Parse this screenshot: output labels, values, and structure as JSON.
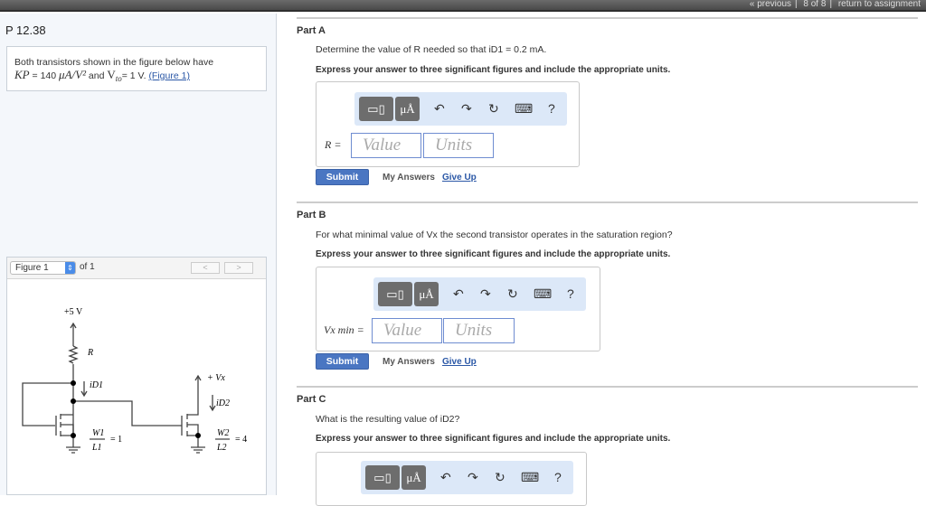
{
  "topbar": {
    "previous": "« previous",
    "position": "8 of 8",
    "return": "return to assignment"
  },
  "problem": {
    "title": "P 12.38",
    "text1": "Both transistors shown in the figure below have",
    "kp": "KP",
    "kp_val": "= 140",
    "kp_units": "μA/V²",
    "and": "and",
    "vto": "V",
    "vto_sub": "to",
    "vto_val": "= 1 V.",
    "figure_link": "(Figure 1)"
  },
  "figure": {
    "select": "Figure 1",
    "of": "of 1",
    "prev": "<",
    "next": ">",
    "labels": {
      "supply": "+5 V",
      "r": "R",
      "id1": "iD1",
      "vx": "+ Vx",
      "id2": "iD2",
      "w1": "W1",
      "l1": "L1",
      "ratio1": "= 1",
      "w2": "W2",
      "l2": "L2",
      "ratio2": "= 4"
    }
  },
  "toolbar": {
    "template": "▭",
    "units": "μÅ",
    "undo": "↶",
    "redo": "↷",
    "reset": "↻",
    "keyboard": "⌨",
    "help": "?"
  },
  "common": {
    "express": "Express your answer to three significant figures and include the appropriate units.",
    "value_ph": "Value",
    "units_ph": "Units",
    "submit": "Submit",
    "my_answers": "My Answers",
    "give_up": "Give Up"
  },
  "partA": {
    "title": "Part A",
    "question": "Determine the value of R needed so that iD1 = 0.2 mA.",
    "label": "R ="
  },
  "partB": {
    "title": "Part B",
    "question": "For what minimal value of Vx the second transistor operates in the saturation region?",
    "label": "Vx min ="
  },
  "partC": {
    "title": "Part C",
    "question": "What is the resulting value of iD2?"
  }
}
